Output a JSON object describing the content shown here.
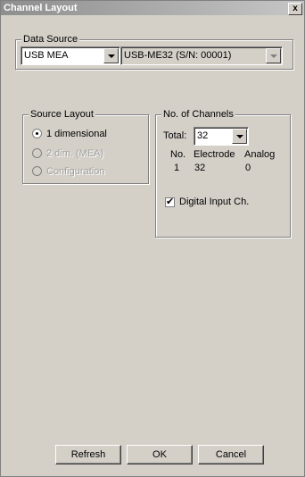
{
  "window": {
    "title": "Channel Layout",
    "close_label": "x"
  },
  "data_source": {
    "legend": "Data Source",
    "type_value": "USB MEA",
    "device_value": "USB-ME32  (S/N: 00001)"
  },
  "source_layout": {
    "legend": "Source Layout",
    "options": [
      {
        "label": "1 dimensional",
        "checked": true,
        "enabled": true
      },
      {
        "label": "2 dim. (MEA)",
        "checked": false,
        "enabled": false
      },
      {
        "label": "Configuration",
        "checked": false,
        "enabled": false
      }
    ]
  },
  "channels": {
    "legend": "No. of Channels",
    "total_label": "Total:",
    "total_value": "32",
    "headers": [
      "No.",
      "Electrode",
      "Analog"
    ],
    "row": [
      "1",
      "32",
      "0"
    ],
    "digital_input_label": "Digital Input Ch.",
    "digital_input_checked": true
  },
  "buttons": {
    "refresh": "Refresh",
    "ok": "OK",
    "cancel": "Cancel"
  }
}
